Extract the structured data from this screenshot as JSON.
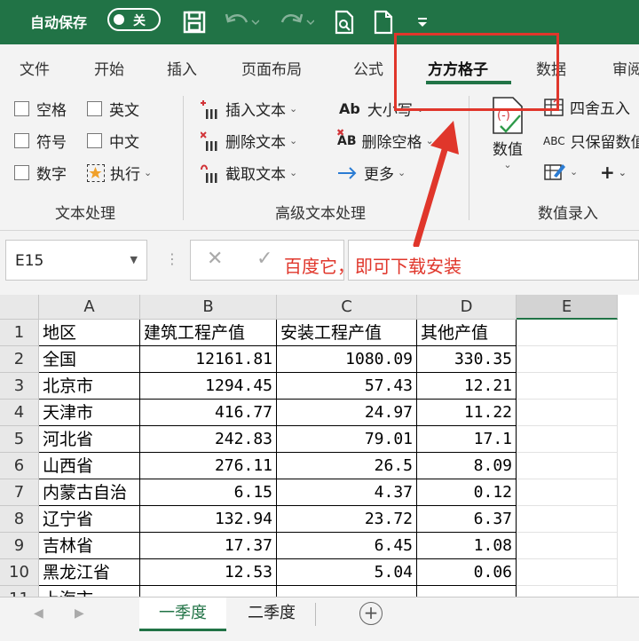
{
  "titlebar": {
    "autosave_label": "自动保存",
    "autosave_state": "关",
    "icons": [
      "save-icon",
      "undo-icon",
      "redo-icon",
      "print-preview-icon",
      "new-file-icon",
      "customize-qat-icon"
    ]
  },
  "tabs": [
    "文件",
    "开始",
    "插入",
    "页面布局",
    "公式",
    "方方格子",
    "数据",
    "审阅"
  ],
  "active_tab": "方方格子",
  "ribbon": {
    "text_group": {
      "label": "文本处理",
      "checkboxes": [
        "空格",
        "英文",
        "符号",
        "中文",
        "数字"
      ],
      "exec_label": "执行"
    },
    "adv_group": {
      "label": "高级文本处理",
      "insert_text": "插入文本",
      "delete_text": "删除文本",
      "cut_text": "截取文本",
      "case_label": "大小写",
      "case_icon_text": "Ab",
      "remove_space": "删除空格",
      "remove_space_icon_text": "AB",
      "more": "更多"
    },
    "num_group": {
      "label": "数值录入",
      "value_label": "数值",
      "round": "四舍五入",
      "keep_num": "只保留数值",
      "keep_num_icon_text": "ABC"
    }
  },
  "formula_bar": {
    "name_box": "E15",
    "annotation": "百度它，即可下载安装"
  },
  "sheet": {
    "columns": [
      "A",
      "B",
      "C",
      "D",
      "E"
    ],
    "selected_column": "E",
    "rows": [
      {
        "n": "1",
        "a": "地区",
        "b": "建筑工程产值",
        "c": "安装工程产值",
        "d": "其他产值"
      },
      {
        "n": "2",
        "a": "全国",
        "b": "12161.81",
        "c": "1080.09",
        "d": "330.35"
      },
      {
        "n": "3",
        "a": "北京市",
        "b": "1294.45",
        "c": "57.43",
        "d": "12.21"
      },
      {
        "n": "4",
        "a": "天津市",
        "b": "416.77",
        "c": "24.97",
        "d": "11.22"
      },
      {
        "n": "5",
        "a": "河北省",
        "b": "242.83",
        "c": "79.01",
        "d": "17.1"
      },
      {
        "n": "6",
        "a": "山西省",
        "b": "276.11",
        "c": "26.5",
        "d": "8.09"
      },
      {
        "n": "7",
        "a": "内蒙古自治",
        "b": "6.15",
        "c": "4.37",
        "d": "0.12"
      },
      {
        "n": "8",
        "a": "辽宁省",
        "b": "132.94",
        "c": "23.72",
        "d": "6.37"
      },
      {
        "n": "9",
        "a": "吉林省",
        "b": "17.37",
        "c": "6.45",
        "d": "1.08"
      },
      {
        "n": "10",
        "a": "黑龙江省",
        "b": "12.53",
        "c": "5.04",
        "d": "0.06"
      },
      {
        "n": "11",
        "a": "上海市",
        "b": "",
        "c": "",
        "d": ""
      }
    ]
  },
  "sheet_tabs": [
    "一季度",
    "二季度"
  ],
  "active_sheet": "一季度",
  "colors": {
    "brand": "#217346",
    "annotation": "#e0362b"
  }
}
